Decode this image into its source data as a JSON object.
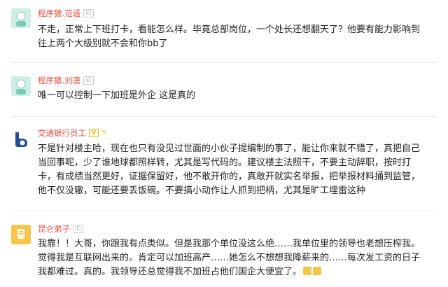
{
  "comments": [
    {
      "username": "程序猿.范遥",
      "badge": "ID",
      "lines": [
        "不走，正常上下班打卡，看能怎么样。毕竟总部岗位，一个处长还想翻天了？他要有能力影响到",
        "往上两个大级别就不会和你bb了"
      ]
    },
    {
      "username": "程序猿.刘唐",
      "badge": "ID",
      "lines": [
        "唯一可以控制一下加班是外企 这是真的"
      ]
    },
    {
      "username": "交通银行员工",
      "badge": "V",
      "lines": [
        "不是针对楼主哈，现在也只有没见过世面的小伙子提编制的事了，能让你来就不错了，真把自己",
        "当回事呢，少了谁地球都照样转，尤其是写代码的。建议楼主法照干，不要主动辞职，按时打",
        "卡，有成绩当然更好，证据保留好，他不敢开你的，真敢开就实名举报，把举报材料捅到监管，",
        "他不仅没辙，可能还要丢饭碗。不要搞小动作让人抓到把柄，尤其是旷工埋雷这种"
      ]
    },
    {
      "username": "昆仑弟子",
      "badge": "ID",
      "lines": [
        "我靠！！大哥，你跟我有点类似。但是我那个单位没这么绝……我单位里的领导也老想压榨我。",
        "觉得我是互联网出来的。肯定可以加班高产……她怎么不想想我降薪来的……每次发工资的日子",
        "我都难过。真的。我领导还总觉得我不加班占他们国企大便宜了。"
      ]
    }
  ]
}
